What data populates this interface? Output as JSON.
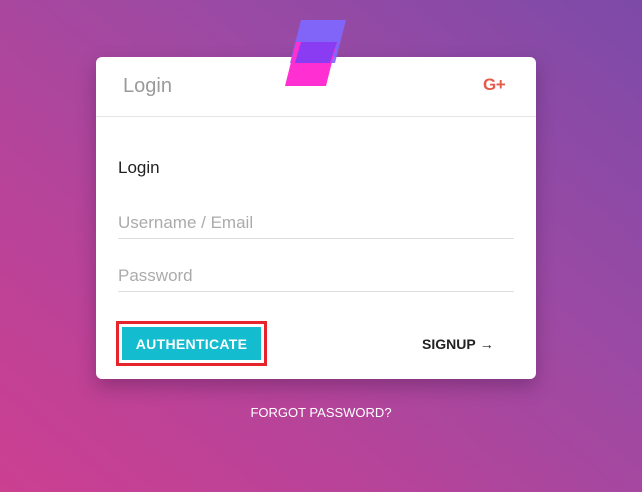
{
  "colors": {
    "background_start": "#cc3f91",
    "background_end": "#7d4aa8",
    "accent": "#14bcd0",
    "highlight_outline": "#e5252b",
    "google_plus": "#e35b4a",
    "logo_front": "#ff2fd1",
    "logo_back": "#7f66ff"
  },
  "logo": {
    "icon": "app-logo-icon"
  },
  "card": {
    "header_title": "Login",
    "google_plus_label": "G+",
    "google_plus_icon": "google-plus-icon"
  },
  "form": {
    "title": "Login",
    "username": {
      "value": "",
      "placeholder": "Username / Email"
    },
    "password": {
      "value": "",
      "placeholder": "Password"
    },
    "authenticate_label": "AUTHENTICATE",
    "signup_label": "SIGNUP",
    "signup_arrow": "→"
  },
  "footer": {
    "forgot_password_label": "FORGOT PASSWORD?"
  }
}
